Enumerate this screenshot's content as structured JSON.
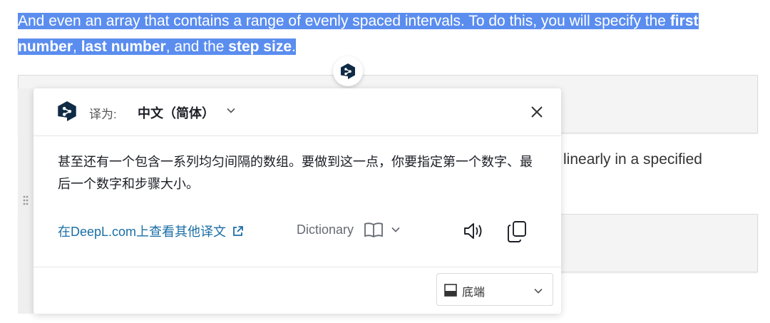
{
  "page": {
    "para_part1": "And even an array that contains a range of evenly spaced intervals. To do this, you will specify the ",
    "bold_first_number": "first number",
    "sep1": ", ",
    "bold_last_number": "last number",
    "sep2": ", and the ",
    "bold_step_size": "step size",
    "end": ".",
    "para2_fragment": "linearly in a specified"
  },
  "popup": {
    "target_label": "译为:",
    "target_language": "中文（简体）",
    "translation": "甚至还有一个包含一系列均匀间隔的数组。要做到这一点，你要指定第一个数字、最后一个数字和步骤大小。",
    "alt_link": "在DeepL.com上查看其他译文",
    "dictionary_label": "Dictionary",
    "position_value": "底端"
  },
  "colors": {
    "selection": "#5b8def",
    "link": "#1a6ea6",
    "deepl_brand": "#0f2b46"
  },
  "icons": [
    "deepl-logo-icon",
    "chevron-down-icon",
    "close-icon",
    "external-link-icon",
    "book-icon",
    "speaker-icon",
    "copy-icon",
    "dock-bottom-icon",
    "drag-handle-icon"
  ]
}
